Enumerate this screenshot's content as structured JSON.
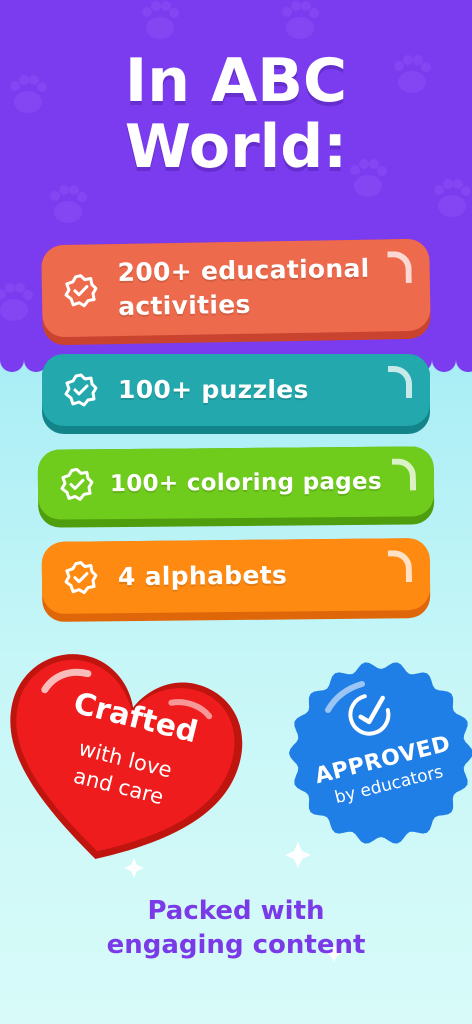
{
  "headline": {
    "line1": "In ABC",
    "line2": "World:"
  },
  "features": [
    {
      "line1": "200+ educational",
      "line2": "activities",
      "color": "#ee6a4d",
      "icon": "check-badge-icon"
    },
    {
      "line1": "100+ puzzles",
      "color": "#22a8ad",
      "icon": "check-badge-icon"
    },
    {
      "line1": "100+ coloring pages",
      "color": "#6fcb1c",
      "icon": "check-badge-icon"
    },
    {
      "line1": "4 alphabets",
      "color": "#ff8a12",
      "icon": "check-badge-icon"
    }
  ],
  "heart": {
    "title": "Crafted",
    "line1": "with love",
    "line2": "and care",
    "color": "#ee1c1c",
    "icon": "heart-icon"
  },
  "badge": {
    "title": "APPROVED",
    "subtitle": "by educators",
    "color": "#1f7fe6",
    "icon": "check-badge-icon"
  },
  "footer": {
    "line1": "Packed with",
    "line2": "engaging content",
    "color": "#7a3ae8"
  },
  "colors": {
    "top_background": "#7b3cf0",
    "bottom_background": "#bff4f6"
  }
}
